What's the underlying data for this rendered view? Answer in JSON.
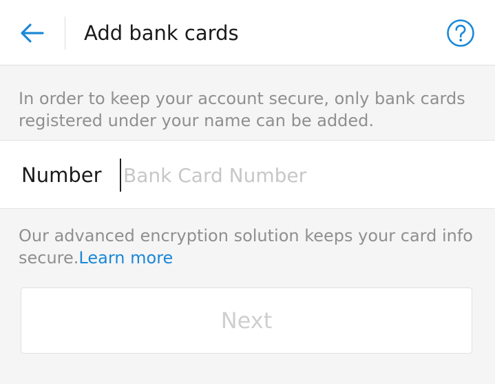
{
  "header": {
    "title": "Add bank cards",
    "back_icon": "arrow-left-icon",
    "help_icon": "question-circle-icon",
    "accent_color": "#1a88d6"
  },
  "notice": {
    "text": "In order to keep your account secure, only bank cards registered under your name can be added."
  },
  "card_number": {
    "label": "Number",
    "placeholder": "Bank Card Number",
    "value": ""
  },
  "encryption": {
    "text": "Our advanced encryption solution keeps your card info secure.",
    "link": "Learn more"
  },
  "next_button": {
    "label": "Next",
    "enabled": false
  }
}
